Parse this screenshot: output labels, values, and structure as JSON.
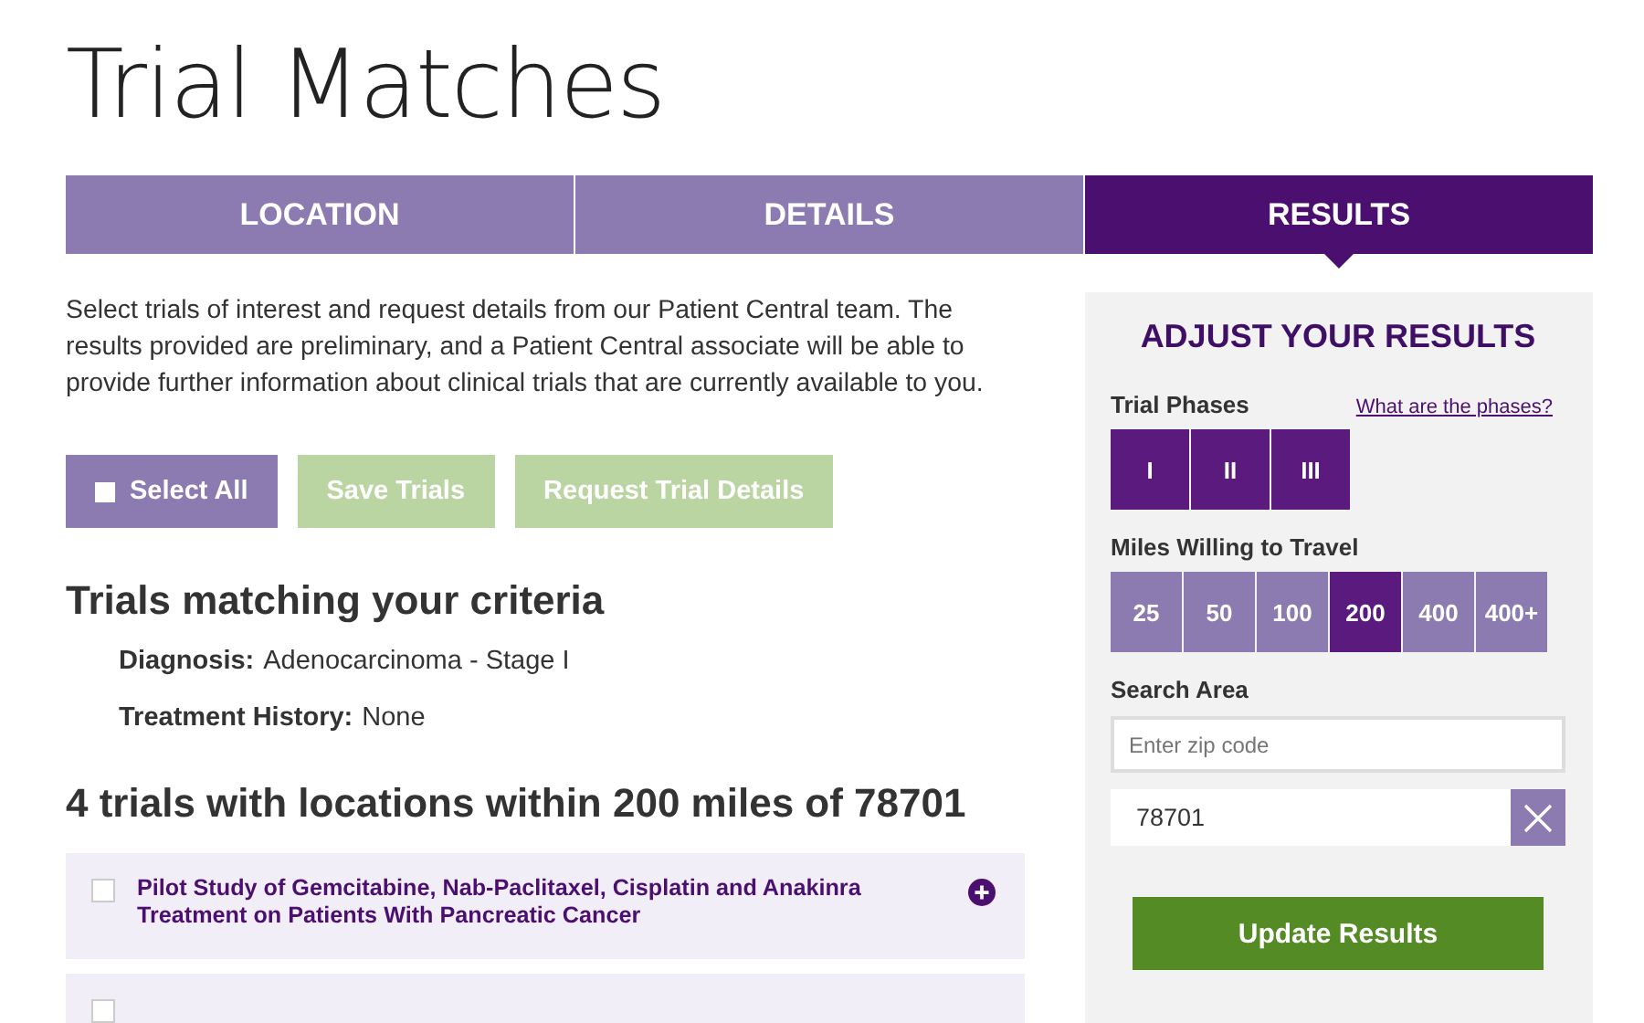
{
  "page_title": "Trial Matches",
  "tabs": [
    {
      "label": "LOCATION",
      "selected": false
    },
    {
      "label": "DETAILS",
      "selected": false
    },
    {
      "label": "RESULTS",
      "selected": true
    }
  ],
  "intro": "Select trials of interest and request details from our Patient Central team. The results provided are preliminary, and a Patient Central associate will be able to provide further information about clinical trials that are currently available to you.",
  "actions": [
    {
      "label": "Select All",
      "kind": "select",
      "checked": false,
      "disabled": false
    },
    {
      "label": "Save Trials",
      "kind": "plain",
      "disabled": true
    },
    {
      "label": "Request Trial Details",
      "kind": "plain",
      "disabled": true
    }
  ],
  "criteria_heading": "Trials matching your criteria",
  "criteria": [
    {
      "label": "Diagnosis:",
      "value": "Adenocarcinoma - Stage I"
    },
    {
      "label": "Treatment History:",
      "value": "None"
    }
  ],
  "results_heading": "4 trials with locations within 200 miles of 78701",
  "trials": [
    {
      "title": "Pilot Study of Gemcitabine, Nab-Paclitaxel, Cisplatin and Anakinra Treatment on Patients With Pancreatic Cancer",
      "checked": false
    },
    {
      "checked": false
    }
  ],
  "panel": {
    "title": "ADJUST YOUR RESULTS",
    "phases_label": "Trial Phases",
    "phases_link": "What are the phases?",
    "phases": [
      {
        "label": "I",
        "selected": true
      },
      {
        "label": "II",
        "selected": true
      },
      {
        "label": "III",
        "selected": true
      }
    ],
    "miles_label": "Miles Willing to Travel",
    "miles": [
      {
        "label": "25",
        "selected": false
      },
      {
        "label": "50",
        "selected": false
      },
      {
        "label": "100",
        "selected": false
      },
      {
        "label": "200",
        "selected": true
      },
      {
        "label": "400",
        "selected": false
      },
      {
        "label": "400+",
        "selected": false
      }
    ],
    "area_label": "Search Area",
    "zip_placeholder": "Enter zip code",
    "zip_value": "78701",
    "update_button": "Update Results"
  }
}
